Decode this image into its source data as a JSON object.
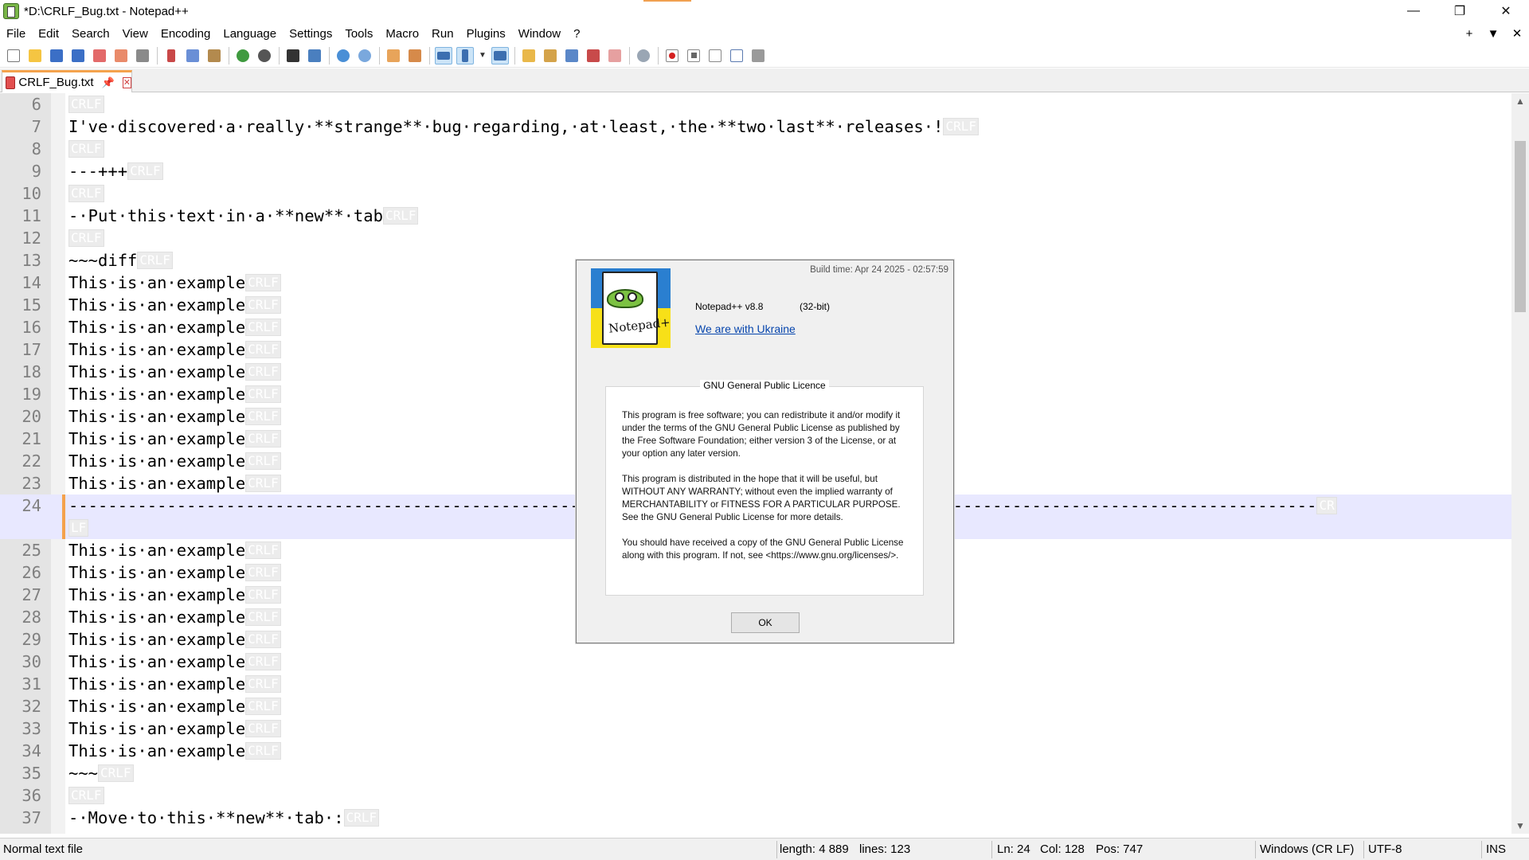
{
  "window": {
    "title": "*D:\\CRLF_Bug.txt - Notepad++",
    "minimize": "—",
    "restore": "❐",
    "close": "✕"
  },
  "menu": {
    "items": [
      "File",
      "Edit",
      "Search",
      "View",
      "Encoding",
      "Language",
      "Settings",
      "Tools",
      "Macro",
      "Run",
      "Plugins",
      "Window",
      "?"
    ],
    "right": [
      "+",
      "▼",
      "✕"
    ]
  },
  "toolbar": {
    "icons": [
      "new-file-icon",
      "open-file-icon",
      "save-icon",
      "save-all-icon",
      "close-icon",
      "close-all-icon",
      "print-icon",
      "cut-icon",
      "copy-icon",
      "paste-icon",
      "undo-icon",
      "redo-icon",
      "find-icon",
      "replace-icon",
      "zoom-in-icon",
      "zoom-out-icon",
      "sync-vertical-icon",
      "sync-horizontal-icon",
      "word-wrap-icon",
      "show-all-chars-icon",
      "dropdown-icon",
      "indent-guide-icon",
      "udl-icon",
      "doc-map-icon",
      "function-list-icon",
      "folder-workspace-icon",
      "monitoring-icon",
      "preview-icon",
      "record-macro-icon",
      "stop-macro-icon",
      "play-macro-icon",
      "run-macro-multiple-icon",
      "save-macro-icon"
    ]
  },
  "tab": {
    "label": "CRLF_Bug.txt",
    "pin": "📌",
    "close": "✕"
  },
  "editor": {
    "eol_marker": "CRLF",
    "current_line": 24,
    "lines": [
      {
        "n": "6",
        "text": "",
        "eol": "CRLF"
      },
      {
        "n": "7",
        "text": "I've·discovered·a·really·**strange**·bug·regarding,·at·least,·the·**two·last**·releases·!",
        "eol": "CRLF"
      },
      {
        "n": "8",
        "text": "",
        "eol": "CRLF"
      },
      {
        "n": "9",
        "text": "---+++",
        "eol": "CRLF"
      },
      {
        "n": "10",
        "text": "",
        "eol": "CRLF"
      },
      {
        "n": "11",
        "text": "-·Put·this·text·in·a·**new**·tab",
        "eol": "CRLF"
      },
      {
        "n": "12",
        "text": "",
        "eol": "CRLF"
      },
      {
        "n": "13",
        "text": "~~~diff",
        "eol": "CRLF"
      },
      {
        "n": "14",
        "text": "This·is·an·example",
        "eol": "CRLF"
      },
      {
        "n": "15",
        "text": "This·is·an·example",
        "eol": "CRLF"
      },
      {
        "n": "16",
        "text": "This·is·an·example",
        "eol": "CRLF"
      },
      {
        "n": "17",
        "text": "This·is·an·example",
        "eol": "CRLF"
      },
      {
        "n": "18",
        "text": "This·is·an·example",
        "eol": "CRLF"
      },
      {
        "n": "19",
        "text": "This·is·an·example",
        "eol": "CRLF"
      },
      {
        "n": "20",
        "text": "This·is·an·example",
        "eol": "CRLF"
      },
      {
        "n": "21",
        "text": "This·is·an·example",
        "eol": "CRLF"
      },
      {
        "n": "22",
        "text": "This·is·an·example",
        "eol": "CRLF"
      },
      {
        "n": "23",
        "text": "This·is·an·example",
        "eol": "CRLF"
      },
      {
        "n": "24",
        "text": "-------------------------------------------------------------------------------------------------------------------------------",
        "eol": "CR",
        "wrap_eol": "LF"
      },
      {
        "n": "25",
        "text": "This·is·an·example",
        "eol": "CRLF"
      },
      {
        "n": "26",
        "text": "This·is·an·example",
        "eol": "CRLF"
      },
      {
        "n": "27",
        "text": "This·is·an·example",
        "eol": "CRLF"
      },
      {
        "n": "28",
        "text": "This·is·an·example",
        "eol": "CRLF"
      },
      {
        "n": "29",
        "text": "This·is·an·example",
        "eol": "CRLF"
      },
      {
        "n": "30",
        "text": "This·is·an·example",
        "eol": "CRLF"
      },
      {
        "n": "31",
        "text": "This·is·an·example",
        "eol": "CRLF"
      },
      {
        "n": "32",
        "text": "This·is·an·example",
        "eol": "CRLF"
      },
      {
        "n": "33",
        "text": "This·is·an·example",
        "eol": "CRLF"
      },
      {
        "n": "34",
        "text": "This·is·an·example",
        "eol": "CRLF"
      },
      {
        "n": "35",
        "text": "~~~",
        "eol": "CRLF"
      },
      {
        "n": "36",
        "text": "",
        "eol": "CRLF"
      },
      {
        "n": "37",
        "text": "-·Move·to·this·**new**·tab·:",
        "eol": "CRLF"
      }
    ]
  },
  "statusbar": {
    "file_type": "Normal text file",
    "length": "length: 4 889",
    "lines": "lines: 123",
    "ln": "Ln: 24",
    "col": "Col: 128",
    "pos": "Pos: 747",
    "eol_format": "Windows (CR LF)",
    "encoding": "UTF-8",
    "mode": "INS"
  },
  "about_dialog": {
    "build_time": "Build time: Apr 24 2025 - 02:57:59",
    "version": "Notepad++ v8.8",
    "bits": "(32-bit)",
    "link": "We are with Ukraine",
    "logo_word": "Notepad++",
    "gpl_title": "GNU General Public Licence",
    "gpl_paragraphs": [
      "This program is free software; you can redistribute it and/or modify it under the terms of the GNU General Public License as published by the Free Software Foundation; either version 3 of the License, or at your option any later version.",
      "This program is distributed in the hope that it will be useful, but WITHOUT ANY WARRANTY; without even the implied warranty of MERCHANTABILITY or FITNESS FOR A PARTICULAR PURPOSE. See the GNU General Public License for more details.",
      "You should have received a copy of the GNU General Public License along with this program. If not, see <https://www.gnu.org/licenses/>."
    ],
    "ok_label": "OK"
  },
  "colors": {
    "accent": "#f4a24c",
    "current_line": "#e8e8ff",
    "link": "#0645ad",
    "gutter": "#e4e4e4"
  }
}
